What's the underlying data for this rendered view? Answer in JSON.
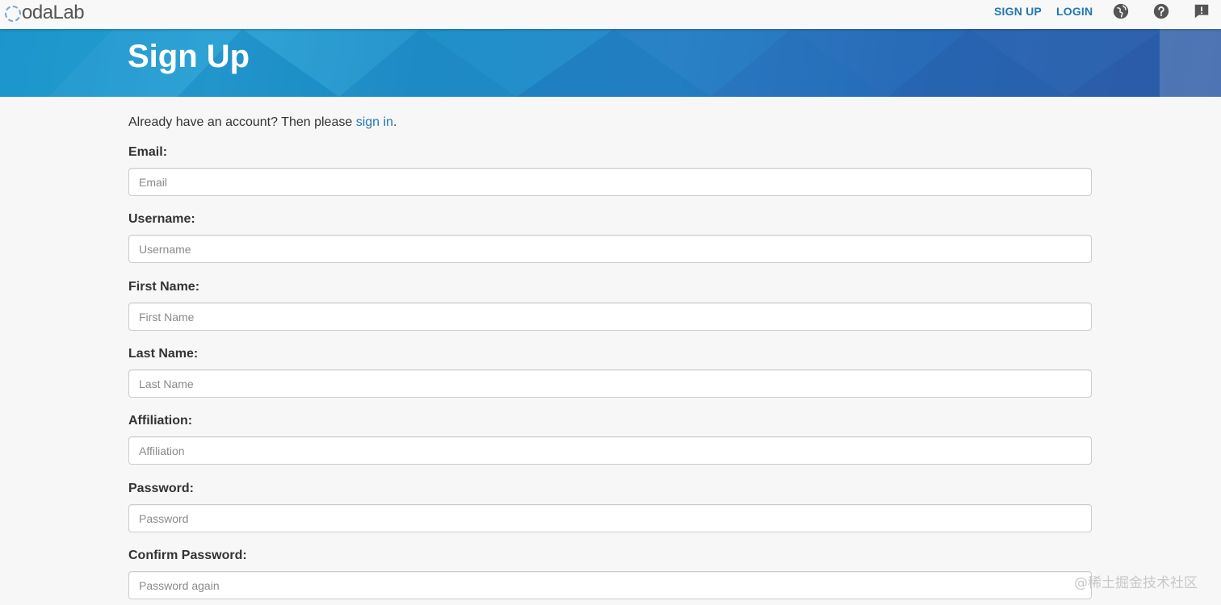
{
  "header": {
    "logo_text": "odaLab",
    "nav": {
      "signup": "SIGN UP",
      "login": "LOGIN"
    },
    "icons": [
      "globe-icon",
      "help-icon",
      "feedback-icon"
    ],
    "accent_color": "#1f77b4"
  },
  "banner": {
    "title": "Sign Up"
  },
  "intro": {
    "text": "Already have an account? Then please ",
    "link": "sign in",
    "suffix": "."
  },
  "form": {
    "email": {
      "label": "Email:",
      "placeholder": "Email"
    },
    "username": {
      "label": "Username:",
      "placeholder": "Username"
    },
    "first_name": {
      "label": "First Name:",
      "placeholder": "First Name"
    },
    "last_name": {
      "label": "Last Name:",
      "placeholder": "Last Name"
    },
    "affiliation": {
      "label": "Affiliation:",
      "placeholder": "Affiliation"
    },
    "password": {
      "label": "Password:",
      "placeholder": "Password"
    },
    "confirm_password": {
      "label": "Confirm Password:",
      "placeholder": "Password again"
    }
  },
  "watermark": "@稀土掘金技术社区"
}
